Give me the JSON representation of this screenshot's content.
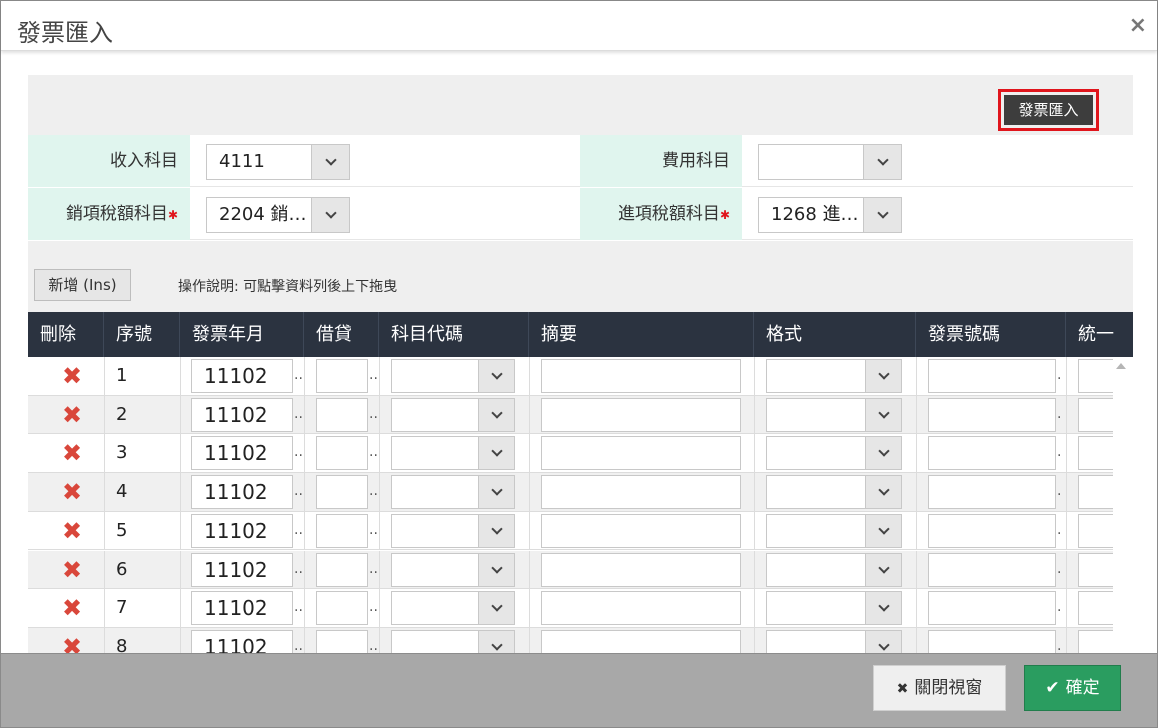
{
  "dialog": {
    "title": "發票匯入",
    "close_glyph": "×"
  },
  "toolbar": {
    "import_label": "發票匯入"
  },
  "form": {
    "income_label": "收入科目",
    "income_value": "4111",
    "expense_label": "費用科目",
    "expense_value": "",
    "output_tax_label": "銷項稅額科目",
    "output_tax_value": "2204 銷…",
    "input_tax_label": "進項稅額科目",
    "input_tax_value": "1268 進…",
    "required_mark": "✱"
  },
  "actions": {
    "add_label": "新增 (Ins)",
    "help_text": "操作說明: 可點擊資料列後上下拖曳"
  },
  "table": {
    "headers": [
      "刪除",
      "序號",
      "發票年月",
      "借貸",
      "科目代碼",
      "摘要",
      "格式",
      "發票號碼",
      "統一"
    ],
    "rows": [
      {
        "seq": "1",
        "ym": "11102"
      },
      {
        "seq": "2",
        "ym": "11102"
      },
      {
        "seq": "3",
        "ym": "11102"
      },
      {
        "seq": "4",
        "ym": "11102"
      },
      {
        "seq": "5",
        "ym": "11102"
      },
      {
        "seq": "6",
        "ym": "11102"
      },
      {
        "seq": "7",
        "ym": "11102"
      },
      {
        "seq": "8",
        "ym": "11102"
      }
    ],
    "delete_glyph": "✖",
    "ellipsis": ".."
  },
  "footer": {
    "close_label": "關閉視窗",
    "close_glyph": "✖",
    "ok_label": "確定",
    "ok_glyph": "✔"
  },
  "colors": {
    "header_bg": "#2b3340",
    "label_bg": "#e0f5ee",
    "ok_green": "#2a9d60",
    "highlight_red": "#e0151c",
    "delete_red": "#d9473b"
  }
}
